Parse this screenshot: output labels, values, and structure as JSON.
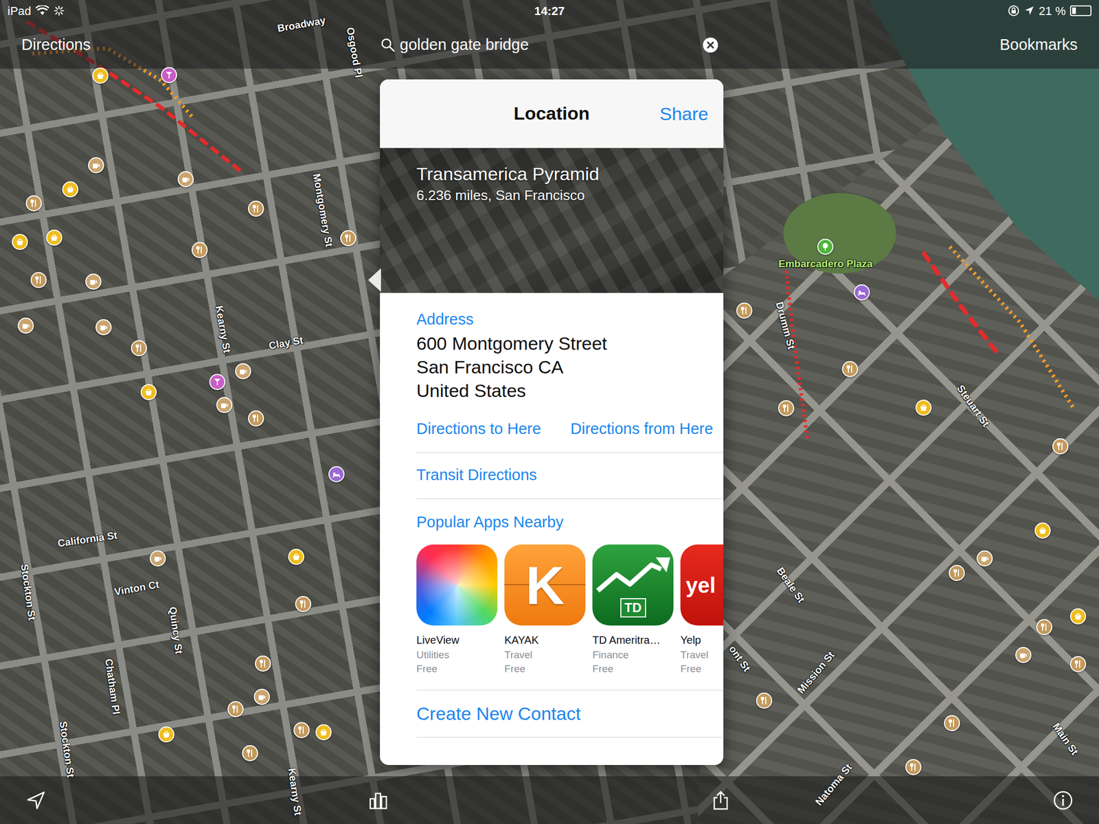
{
  "status_bar": {
    "device": "iPad",
    "time": "14:27",
    "battery": "21 %",
    "battery_level": 0.21
  },
  "nav_bar": {
    "left": "Directions",
    "search": {
      "value": "golden gate bridge"
    },
    "right": "Bookmarks"
  },
  "popover": {
    "title": "Location",
    "share": "Share",
    "place": {
      "name": "Transamerica Pyramid",
      "subtitle": "6.236 miles, San Francisco"
    },
    "address_label": "Address",
    "address_lines": [
      "600 Montgomery Street",
      "San Francisco CA",
      "United States"
    ],
    "actions": [
      "Directions to Here",
      "Directions from Here"
    ],
    "transit": "Transit Directions",
    "apps_heading": "Popular Apps Nearby",
    "apps": [
      {
        "name": "LiveView",
        "category": "Utilities",
        "price": "Free",
        "kind": "liveview",
        "icon_text": ""
      },
      {
        "name": "KAYAK",
        "category": "Travel",
        "price": "Free",
        "kind": "kayak",
        "icon_text": "K"
      },
      {
        "name": "TD Ameritra…",
        "category": "Finance",
        "price": "Free",
        "kind": "td",
        "icon_text": "TD"
      },
      {
        "name": "Yelp",
        "category": "Travel",
        "price": "Free",
        "kind": "yelp",
        "icon_text": "yel"
      }
    ],
    "contact": "Create New Contact"
  },
  "map": {
    "labels": [
      {
        "text": "Broadway",
        "kind": "street"
      },
      {
        "text": "Osgood Pl",
        "kind": "street"
      },
      {
        "text": "Montgomery St",
        "kind": "street"
      },
      {
        "text": "Kearny St",
        "kind": "street"
      },
      {
        "text": "Clay St",
        "kind": "street"
      },
      {
        "text": "California St",
        "kind": "street"
      },
      {
        "text": "Stockton St",
        "kind": "street"
      },
      {
        "text": "Vinton Ct",
        "kind": "street"
      },
      {
        "text": "Quincy St",
        "kind": "street"
      },
      {
        "text": "Chatham Pl",
        "kind": "street"
      },
      {
        "text": "Stockton St",
        "kind": "street"
      },
      {
        "text": "Kearny St",
        "kind": "street"
      },
      {
        "text": "Embarcadero Plaza",
        "kind": "park"
      },
      {
        "text": "Drumm St",
        "kind": "street"
      },
      {
        "text": "Steuart St",
        "kind": "street"
      },
      {
        "text": "Beale St",
        "kind": "street"
      },
      {
        "text": "Mission St",
        "kind": "street"
      },
      {
        "text": "ont St",
        "kind": "street"
      },
      {
        "text": "Main St",
        "kind": "street"
      },
      {
        "text": "Natoma St",
        "kind": "street"
      }
    ],
    "pois": [
      {
        "kind": "restaurant"
      },
      {
        "kind": "restaurant"
      },
      {
        "kind": "restaurant"
      },
      {
        "kind": "restaurant"
      },
      {
        "kind": "restaurant"
      },
      {
        "kind": "restaurant"
      },
      {
        "kind": "restaurant"
      },
      {
        "kind": "restaurant"
      },
      {
        "kind": "restaurant"
      },
      {
        "kind": "restaurant"
      },
      {
        "kind": "restaurant"
      },
      {
        "kind": "restaurant"
      },
      {
        "kind": "restaurant"
      },
      {
        "kind": "restaurant"
      },
      {
        "kind": "restaurant"
      },
      {
        "kind": "restaurant"
      },
      {
        "kind": "restaurant"
      },
      {
        "kind": "restaurant"
      },
      {
        "kind": "restaurant"
      },
      {
        "kind": "restaurant"
      },
      {
        "kind": "restaurant"
      },
      {
        "kind": "restaurant"
      },
      {
        "kind": "cafe"
      },
      {
        "kind": "cafe"
      },
      {
        "kind": "cafe"
      },
      {
        "kind": "cafe"
      },
      {
        "kind": "cafe"
      },
      {
        "kind": "cafe"
      },
      {
        "kind": "cafe"
      },
      {
        "kind": "cafe"
      },
      {
        "kind": "cafe"
      },
      {
        "kind": "cafe"
      },
      {
        "kind": "cafe"
      },
      {
        "kind": "shopping"
      },
      {
        "kind": "shopping"
      },
      {
        "kind": "shopping"
      },
      {
        "kind": "shopping"
      },
      {
        "kind": "shopping"
      },
      {
        "kind": "shopping"
      },
      {
        "kind": "shopping"
      },
      {
        "kind": "shopping"
      },
      {
        "kind": "shopping"
      },
      {
        "kind": "shopping"
      },
      {
        "kind": "shopping"
      },
      {
        "kind": "bar"
      },
      {
        "kind": "bar"
      },
      {
        "kind": "hotel"
      },
      {
        "kind": "hotel"
      },
      {
        "kind": "park"
      }
    ]
  }
}
